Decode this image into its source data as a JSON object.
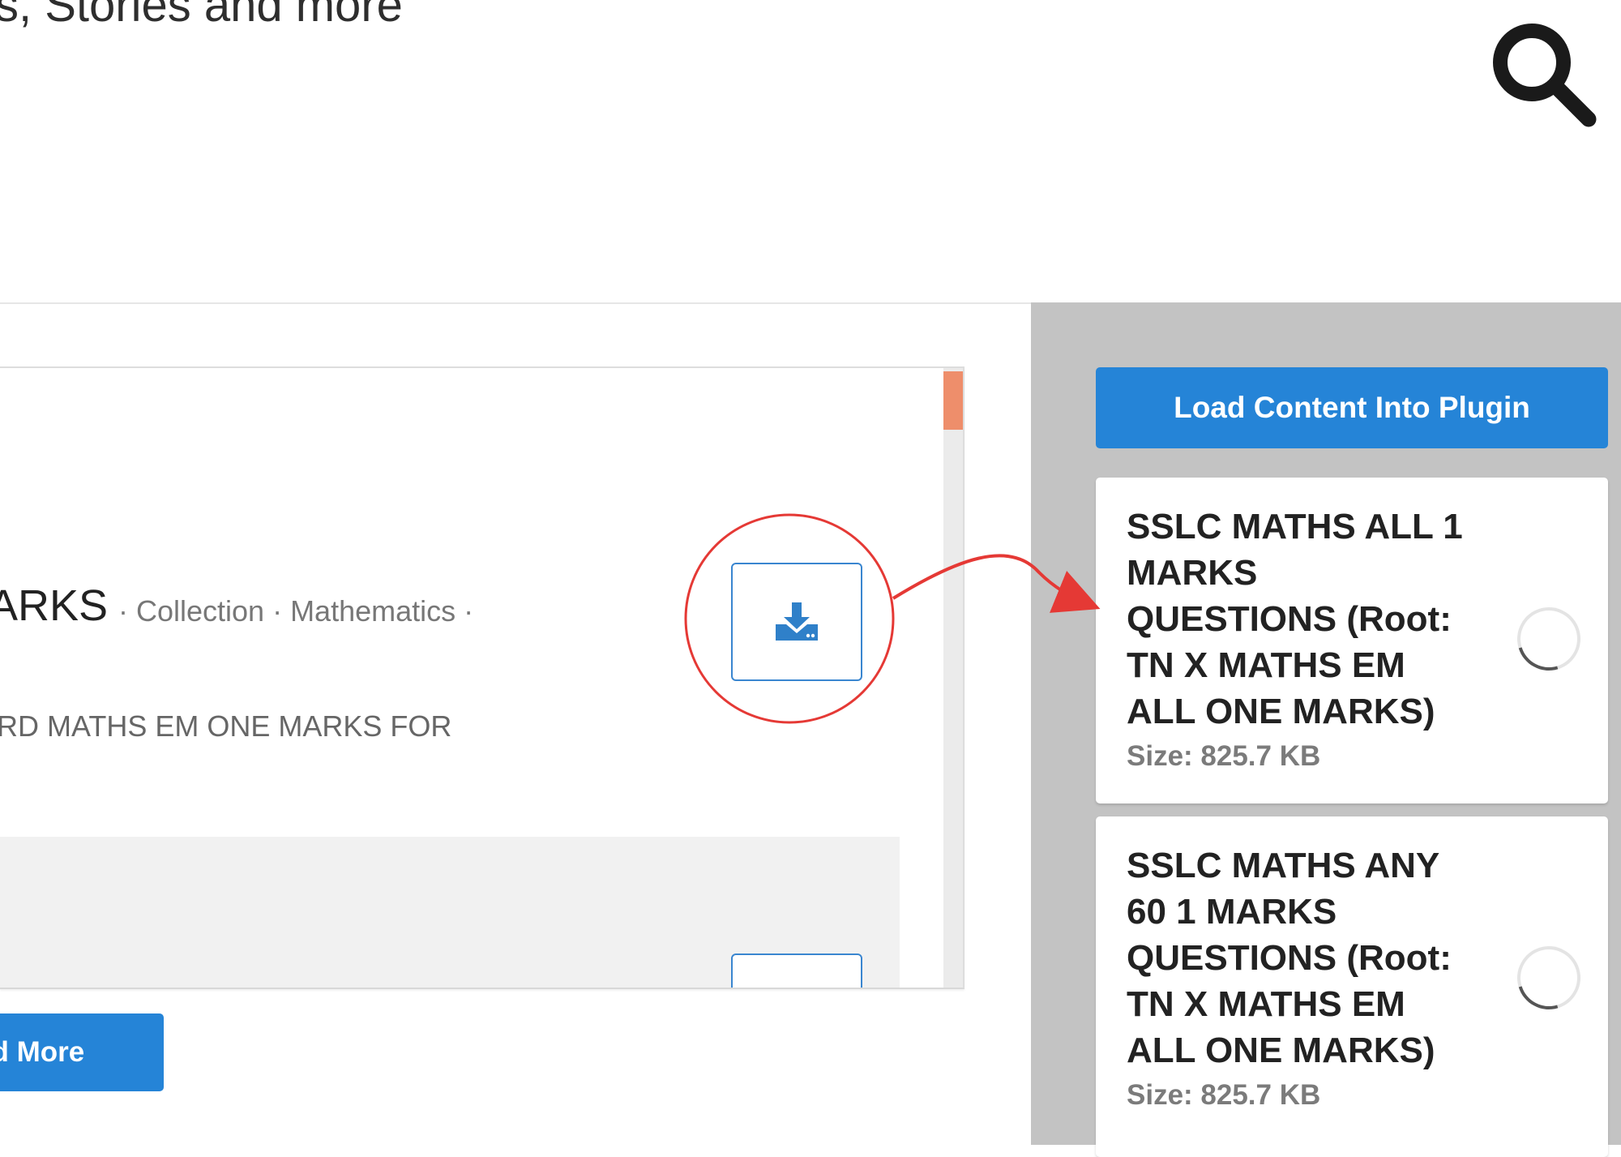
{
  "header": {
    "title": "s, Stories and more",
    "search_icon": "search-icon"
  },
  "results": {
    "item_title": "ARKS",
    "item_meta": "· Collection · Mathematics ·",
    "item_description": "ARD MATHS EM ONE MARKS FOR",
    "download_icon": "download-icon",
    "load_more_label": "ad More"
  },
  "sidebar": {
    "load_button_label": "Load Content Into Plugin",
    "cards": [
      {
        "title": "SSLC MATHS ALL 1 MARKS QUESTIONS (Root: TN X MATHS EM ALL ONE MARKS)",
        "size": "Size: 825.7 KB"
      },
      {
        "title": "SSLC MATHS ANY 60 1 MARKS QUESTIONS (Root: TN X MATHS EM ALL ONE MARKS)",
        "size": "Size: 825.7 KB"
      }
    ]
  },
  "colors": {
    "primary": "#2584d7",
    "sidebar_bg": "#c3c3c3",
    "annotation": "#e53935",
    "scroll_thumb": "#ee8e6b"
  }
}
